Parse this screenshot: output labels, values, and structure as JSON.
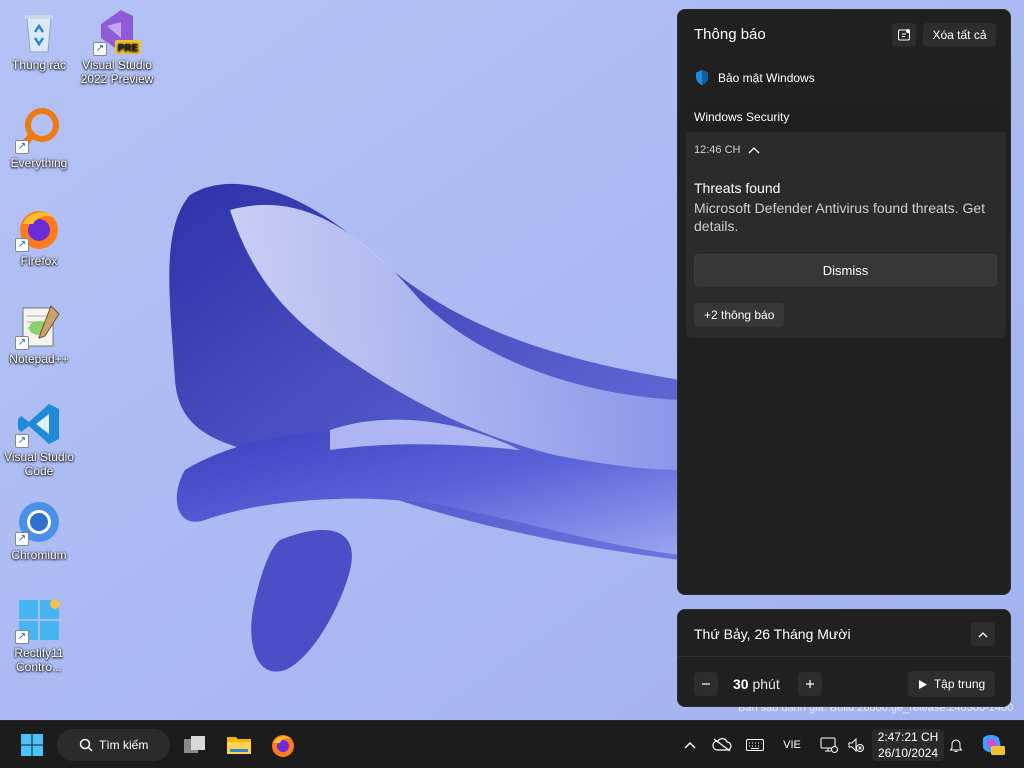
{
  "desktop": {
    "icons": [
      {
        "label": "Thùng rác",
        "icon": "recycle-bin-icon"
      },
      {
        "label": "Visual Studio 2022 Preview",
        "icon": "visual-studio-icon",
        "badge": "PRE"
      },
      {
        "label": "Everything",
        "icon": "everything-search-icon"
      },
      {
        "label": "Firefox",
        "icon": "firefox-icon"
      },
      {
        "label": "Notepad++",
        "icon": "notepad-plus-plus-icon"
      },
      {
        "label": "Visual Studio Code",
        "icon": "vscode-icon"
      },
      {
        "label": "Chromium",
        "icon": "chromium-icon"
      },
      {
        "label": "Rectify11 Contro...",
        "icon": "rectify11-icon"
      }
    ]
  },
  "notifications": {
    "title": "Thông báo",
    "clear_all": "Xóa tất cả",
    "app_name": "Bảo mật Windows",
    "card": {
      "header": "Windows Security",
      "time": "12:46 CH",
      "title": "Threats found",
      "body": "Microsoft Defender Antivirus found threats. Get details.",
      "dismiss": "Dismiss",
      "more": "+2 thông báo"
    }
  },
  "calendar": {
    "date": "Thứ Bảy, 26 Tháng Mười",
    "focus_value": "30",
    "focus_unit": "phút",
    "focus_button": "Tập trung"
  },
  "watermark": "Bản sao đánh giá. Build 26000.ge_release.240300-1400",
  "taskbar": {
    "search_label": "Tìm kiếm",
    "language": "VIE",
    "time": "2:47:21 CH",
    "date": "26/10/2024"
  },
  "colors": {
    "wallpaper": "#a9b8f2",
    "panel_bg": "#202020",
    "taskbar_bg": "#1c1c1c",
    "security_shield": "#1f8ad8"
  }
}
